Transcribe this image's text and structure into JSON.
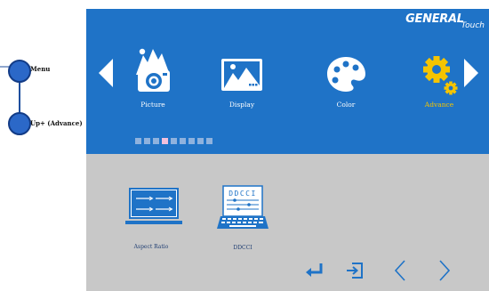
{
  "hardware_buttons": [
    {
      "label": "Menu"
    },
    {
      "label": "Up+ (Advance)"
    }
  ],
  "brand": {
    "name": "GENERAL",
    "suffix": "Touch"
  },
  "menu": {
    "items": [
      {
        "label": "Picture",
        "icon": "picture-icon"
      },
      {
        "label": "Display",
        "icon": "display-icon"
      },
      {
        "label": "Color",
        "icon": "color-palette-icon"
      },
      {
        "label": "Advance",
        "icon": "gear-icon",
        "active": true
      }
    ],
    "page_indicator": {
      "total": 9,
      "current": 4
    }
  },
  "submenu": {
    "items": [
      {
        "label": "Aspect Ratio",
        "icon": "aspect-ratio-icon"
      },
      {
        "label": "DDCCI",
        "icon": "ddcci-icon",
        "icon_text": "DDCCI"
      }
    ]
  },
  "nav_icons": [
    "enter-icon",
    "exit-icon",
    "chevron-left-icon",
    "chevron-right-icon"
  ],
  "colors": {
    "accent": "#f5c400",
    "panel": "#1f73c7",
    "content": "#c8c8c8"
  }
}
